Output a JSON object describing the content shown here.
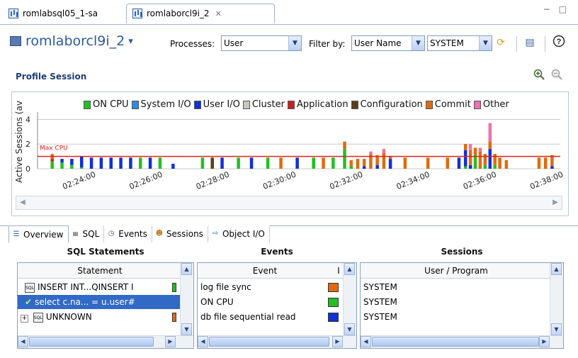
{
  "tabs": [
    {
      "label": "romlabsql05_1-sa",
      "active": false
    },
    {
      "label": "romlaborcl9i_2",
      "active": true,
      "close_glyph": "✕"
    }
  ],
  "window_controls": "− □",
  "toolbar": {
    "title": "romlaborcl9i_2",
    "title_dropdown_glyph": "▾",
    "processes_label": "Processes:",
    "processes_value": "User",
    "filter_label": "Filter by:",
    "filter_field_value": "User Name",
    "filter_value": "SYSTEM",
    "icons": [
      "refresh-icon",
      "layout-icon",
      "help-icon"
    ]
  },
  "profile": {
    "title": "Profile Session",
    "zoom_in": "zoom-in-icon",
    "zoom_out": "zoom-out-icon"
  },
  "chart_data": {
    "type": "bar",
    "stacked": true,
    "ylabel": "Active Sessions (av",
    "yticks": [
      "0",
      "2",
      "4"
    ],
    "ylim": [
      0,
      4.6
    ],
    "xticks": [
      "02:24:00",
      "02:26:00",
      "02:28:00",
      "02:30:00",
      "02:32:00",
      "02:34:00",
      "02:36:00",
      "02:38:00"
    ],
    "reference_line": {
      "label": "Max CPU",
      "value": 1,
      "color": "#e02020"
    },
    "legend": [
      {
        "name": "ON CPU",
        "color": "#22c022"
      },
      {
        "name": "System I/O",
        "color": "#2a8de0"
      },
      {
        "name": "User I/O",
        "color": "#1030d8"
      },
      {
        "name": "Cluster",
        "color": "#c8c8c0"
      },
      {
        "name": "Application",
        "color": "#c82020"
      },
      {
        "name": "Configuration",
        "color": "#5a4018"
      },
      {
        "name": "Commit",
        "color": "#e06a10"
      },
      {
        "name": "Other",
        "color": "#f070b0"
      }
    ],
    "bars": [
      {
        "t": 0.04,
        "s": {
          "ON CPU": 0.6,
          "Commit": 0.4,
          "Application": 0.2
        }
      },
      {
        "t": 0.07,
        "s": {
          "ON CPU": 0.5,
          "User I/O": 0.3
        }
      },
      {
        "t": 0.1,
        "s": {
          "ON CPU": 0.3,
          "User I/O": 0.5
        }
      },
      {
        "t": 0.13,
        "s": {
          "User I/O": 0.9,
          "ON CPU": 0.1
        }
      },
      {
        "t": 0.16,
        "s": {
          "User I/O": 0.9
        }
      },
      {
        "t": 0.19,
        "s": {
          "User I/O": 0.9
        }
      },
      {
        "t": 0.22,
        "s": {
          "User I/O": 0.9
        }
      },
      {
        "t": 0.25,
        "s": {
          "User I/O": 0.9
        }
      },
      {
        "t": 0.28,
        "s": {
          "User I/O": 0.9
        }
      },
      {
        "t": 0.31,
        "s": {
          "ON CPU": 0.9
        }
      },
      {
        "t": 0.34,
        "s": {
          "User I/O": 0.9
        }
      },
      {
        "t": 0.37,
        "s": {
          "ON CPU": 0.9
        }
      },
      {
        "t": 0.41,
        "s": {
          "User I/O": 0.4
        }
      },
      {
        "t": 0.5,
        "s": {
          "ON CPU": 0.9
        }
      },
      {
        "t": 0.53,
        "s": {
          "Configuration": 0.9
        }
      },
      {
        "t": 0.56,
        "s": {
          "User I/O": 0.9
        }
      },
      {
        "t": 0.61,
        "s": {
          "ON CPU": 0.9
        }
      },
      {
        "t": 0.65,
        "s": {
          "User I/O": 0.9
        }
      },
      {
        "t": 0.7,
        "s": {
          "ON CPU": 0.9
        }
      },
      {
        "t": 0.74,
        "s": {
          "Commit": 0.9
        }
      },
      {
        "t": 0.79,
        "s": {
          "User I/O": 0.9
        }
      },
      {
        "t": 0.84,
        "s": {
          "ON CPU": 0.9
        }
      },
      {
        "t": 0.87,
        "s": {
          "Commit": 0.9
        }
      },
      {
        "t": 0.9,
        "s": {
          "ON CPU": 0.9
        }
      },
      {
        "t": 0.935,
        "s": {
          "ON CPU": 1.6,
          "Commit": 0.6
        }
      },
      {
        "t": 0.955,
        "s": {
          "Commit": 0.5,
          "ON CPU": 0.2
        }
      },
      {
        "t": 0.975,
        "s": {
          "Commit": 0.8
        }
      },
      {
        "t": 0.995,
        "s": {
          "Commit": 0.6,
          "User I/O": 0.2
        }
      },
      {
        "t": 1.015,
        "s": {
          "Commit": 1.2,
          "Other": 0.2
        }
      },
      {
        "t": 1.035,
        "s": {
          "Commit": 0.8,
          "User I/O": 0.3
        }
      },
      {
        "t": 1.055,
        "s": {
          "Commit": 1.3,
          "Other": 0.3
        }
      },
      {
        "t": 1.075,
        "s": {
          "User I/O": 0.8,
          "Commit": 0.2
        }
      },
      {
        "t": 1.12,
        "s": {
          "Commit": 0.9
        }
      },
      {
        "t": 1.19,
        "s": {
          "Commit": 0.9
        }
      },
      {
        "t": 1.25,
        "s": {
          "Commit": 0.9
        }
      },
      {
        "t": 1.285,
        "s": {
          "User I/O": 0.9
        }
      },
      {
        "t": 1.305,
        "s": {
          "User I/O": 1.3,
          "Commit": 0.5,
          "ON CPU": 0.2
        }
      },
      {
        "t": 1.32,
        "s": {
          "Commit": 1.2,
          "User I/O": 0.3,
          "Other": 0.5
        }
      },
      {
        "t": 1.335,
        "s": {
          "ON CPU": 1.1,
          "Commit": 0.6
        }
      },
      {
        "t": 1.35,
        "s": {
          "Commit": 1.4,
          "Other": 0.3
        }
      },
      {
        "t": 1.365,
        "s": {
          "Commit": 0.9,
          "ON CPU": 0.3
        }
      },
      {
        "t": 1.38,
        "s": {
          "User I/O": 1.6,
          "Commit": 0.6,
          "Other": 1.5
        }
      },
      {
        "t": 1.395,
        "s": {
          "Commit": 0.9,
          "ON CPU": 0.3
        }
      },
      {
        "t": 1.41,
        "s": {
          "Commit": 0.9
        }
      },
      {
        "t": 1.43,
        "s": {
          "Commit": 0.7
        }
      },
      {
        "t": 1.53,
        "s": {
          "Commit": 0.9
        }
      },
      {
        "t": 1.55,
        "s": {
          "Commit": 0.9
        }
      },
      {
        "t": 1.57,
        "s": {
          "Commit": 0.9,
          "User I/O": 0.2
        }
      }
    ]
  },
  "bottom_tabs": [
    {
      "label": "Overview",
      "icon": "overview-icon"
    },
    {
      "label": "SQL",
      "icon": "sql-icon"
    },
    {
      "label": "Events",
      "icon": "clock-icon"
    },
    {
      "label": "Sessions",
      "icon": "sessions-icon"
    },
    {
      "label": "Object I/O",
      "icon": "object-io-icon"
    }
  ],
  "sql_panel": {
    "heading": "SQL Statements",
    "column": "Statement",
    "rows": [
      {
        "text": "INSERT INT...QINSERT I",
        "color": "#22c022"
      },
      {
        "text": "select c.na... = u.user#",
        "color": "#e06a10",
        "selected": true
      },
      {
        "text": "UNKNOWN",
        "color": "#e06a10"
      }
    ]
  },
  "events_panel": {
    "heading": "Events",
    "column": "Event",
    "column2": "I",
    "rows": [
      {
        "text": "log file sync",
        "color": "#e06a10"
      },
      {
        "text": "ON CPU",
        "color": "#22c022"
      },
      {
        "text": "db file sequential read",
        "color": "#1030d8"
      }
    ]
  },
  "sessions_panel": {
    "heading": "Sessions",
    "column": "User / Program",
    "rows": [
      {
        "text": "SYSTEM"
      },
      {
        "text": "SYSTEM"
      },
      {
        "text": "SYSTEM"
      }
    ]
  }
}
